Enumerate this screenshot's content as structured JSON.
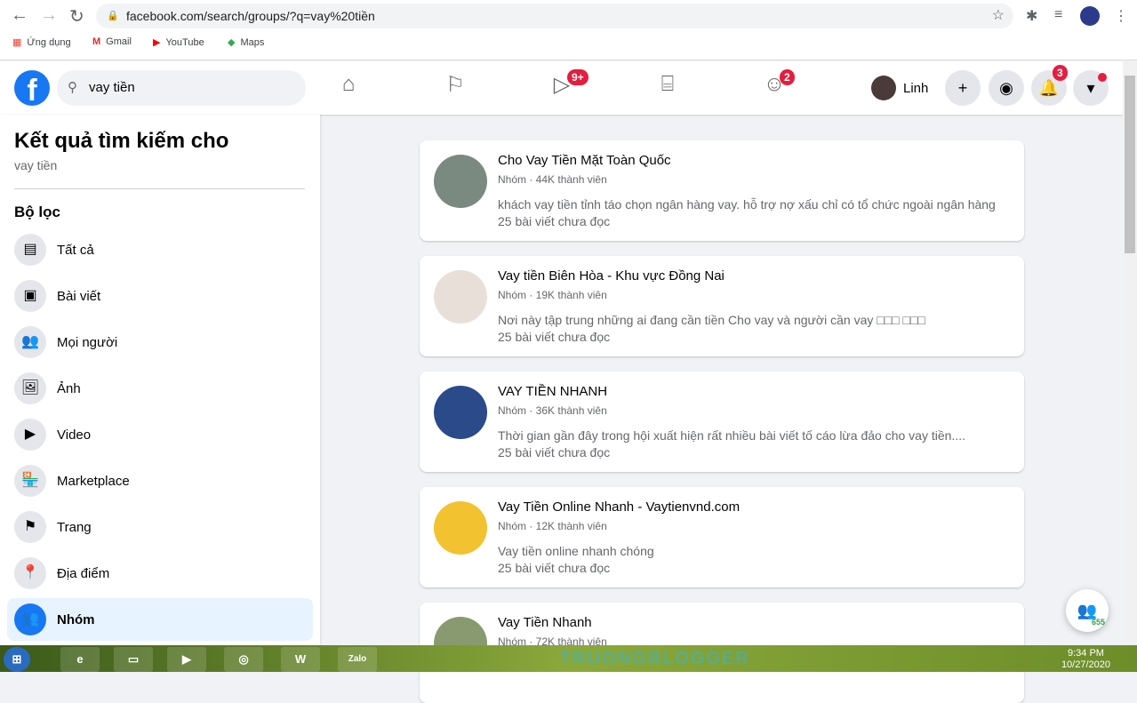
{
  "browser": {
    "url": "facebook.com/search/groups/?q=vay%20tiền",
    "bookmarks": [
      "Ứng dụng",
      "Gmail",
      "YouTube",
      "Maps"
    ]
  },
  "header": {
    "search_value": "vay tiền",
    "watch_badge": "9+",
    "groups_badge": "2",
    "profile_name": "Linh",
    "notif_badge": "3"
  },
  "sidebar": {
    "title": "Kết quả tìm kiếm cho",
    "query": "vay tiền",
    "filter_heading": "Bộ lọc",
    "items": [
      {
        "label": "Tất cả",
        "icon": "▤"
      },
      {
        "label": "Bài viết",
        "icon": "▣"
      },
      {
        "label": "Mọi người",
        "icon": "👥"
      },
      {
        "label": "Ảnh",
        "icon": "🖼"
      },
      {
        "label": "Video",
        "icon": "▶"
      },
      {
        "label": "Marketplace",
        "icon": "🏪"
      },
      {
        "label": "Trang",
        "icon": "⚑"
      },
      {
        "label": "Địa điểm",
        "icon": "📍"
      },
      {
        "label": "Nhóm",
        "icon": "👥"
      }
    ]
  },
  "results": [
    {
      "title": "Cho Vay Tiền Mặt Toàn Quốc",
      "meta": "Nhóm · 44K thành viên",
      "desc": "khách vay tiền tỉnh táo chọn ngân hàng vay. hỗ trợ nợ xấu chỉ có tổ chức ngoài ngân hàng",
      "unread": "25 bài viết chưa đọc",
      "color": "#7a8a80"
    },
    {
      "title": "Vay tiền Biên Hòa - Khu vực Đồng Nai",
      "meta": "Nhóm · 19K thành viên",
      "desc": "Nơi này tập trung những ai đang cần tiền Cho vay và người cần vay □□□ □□□",
      "unread": "25 bài viết chưa đọc",
      "color": "#e8e0d8"
    },
    {
      "title": "VAY TIỀN NHANH",
      "meta": "Nhóm · 36K thành viên",
      "desc": "Thời gian gần đây trong hội xuất hiện rất nhiều bài viết tố cáo lừa đảo cho vay tiền....",
      "unread": "25 bài viết chưa đọc",
      "color": "#2a4a8a"
    },
    {
      "title": "Vay Tiền Online Nhanh - Vaytienvnd.com",
      "meta": "Nhóm · 12K thành viên",
      "desc": "Vay tiền online nhanh chóng",
      "unread": "25 bài viết chưa đọc",
      "color": "#f2c230"
    },
    {
      "title": "Vay Tiền Nhanh",
      "meta": "Nhóm · 72K thành viên",
      "desc": "",
      "unread": "",
      "color": "#8a9a70"
    }
  ],
  "contacts_count": "655",
  "taskbar": {
    "time": "9:34 PM",
    "date": "10/27/2020",
    "zalo": "Zalo"
  },
  "watermark": "TRUONGBLOGGER"
}
